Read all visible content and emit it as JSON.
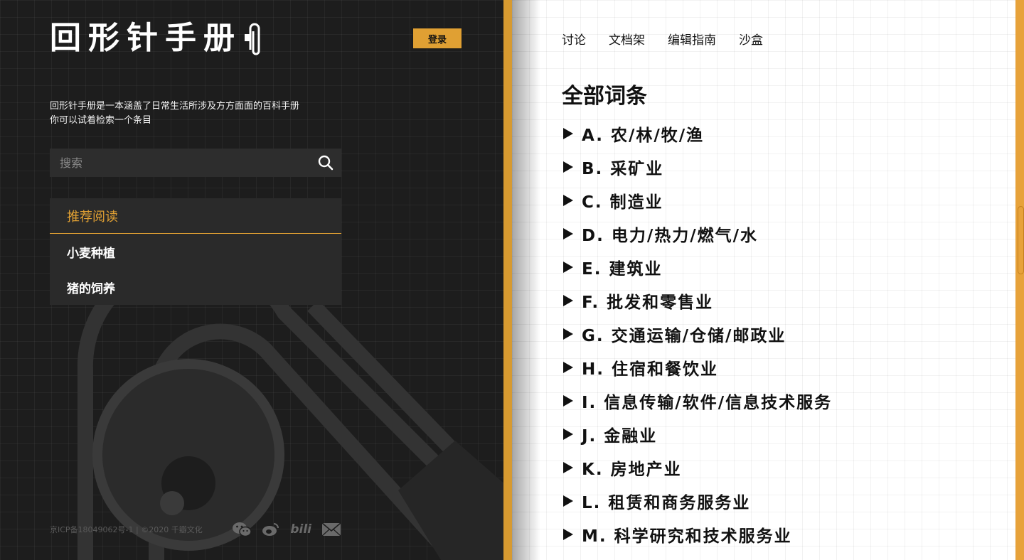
{
  "brand": {
    "logo_text": "回形针手册",
    "login_label": "登录"
  },
  "intro": {
    "line1": "回形针手册是一本涵盖了日常生活所涉及方方面面的百科手册",
    "line2": "你可以试着检索一个条目"
  },
  "search": {
    "placeholder": "搜索",
    "icon": "search-icon"
  },
  "recommend": {
    "title": "推荐阅读",
    "items": [
      {
        "label": "小麦种植"
      },
      {
        "label": "猪的饲养"
      }
    ]
  },
  "footer": {
    "icp": "京ICP备18049062号-1 | ©2020 千瓣文化",
    "social": [
      {
        "icon": "wechat-icon"
      },
      {
        "icon": "weibo-icon"
      },
      {
        "icon": "bilibili-icon",
        "text": "bili"
      },
      {
        "icon": "mail-icon"
      }
    ]
  },
  "nav": {
    "items": [
      {
        "label": "讨论"
      },
      {
        "label": "文档架"
      },
      {
        "label": "编辑指南"
      },
      {
        "label": "沙盒"
      }
    ]
  },
  "main": {
    "title": "全部词条",
    "categories": [
      {
        "label": "A. 农/林/牧/渔"
      },
      {
        "label": "B. 采矿业"
      },
      {
        "label": "C. 制造业"
      },
      {
        "label": "D. 电力/热力/燃气/水"
      },
      {
        "label": "E. 建筑业"
      },
      {
        "label": "F. 批发和零售业"
      },
      {
        "label": "G. 交通运输/仓储/邮政业"
      },
      {
        "label": "H. 住宿和餐饮业"
      },
      {
        "label": "I. 信息传输/软件/信息技术服务"
      },
      {
        "label": "J. 金融业"
      },
      {
        "label": "K. 房地产业"
      },
      {
        "label": "L. 租赁和商务服务业"
      },
      {
        "label": "M. 科学研究和技术服务业"
      }
    ]
  },
  "colors": {
    "accent": "#e0a033",
    "dark_bg": "#1d1d1d",
    "light_bg": "#ffffff"
  }
}
